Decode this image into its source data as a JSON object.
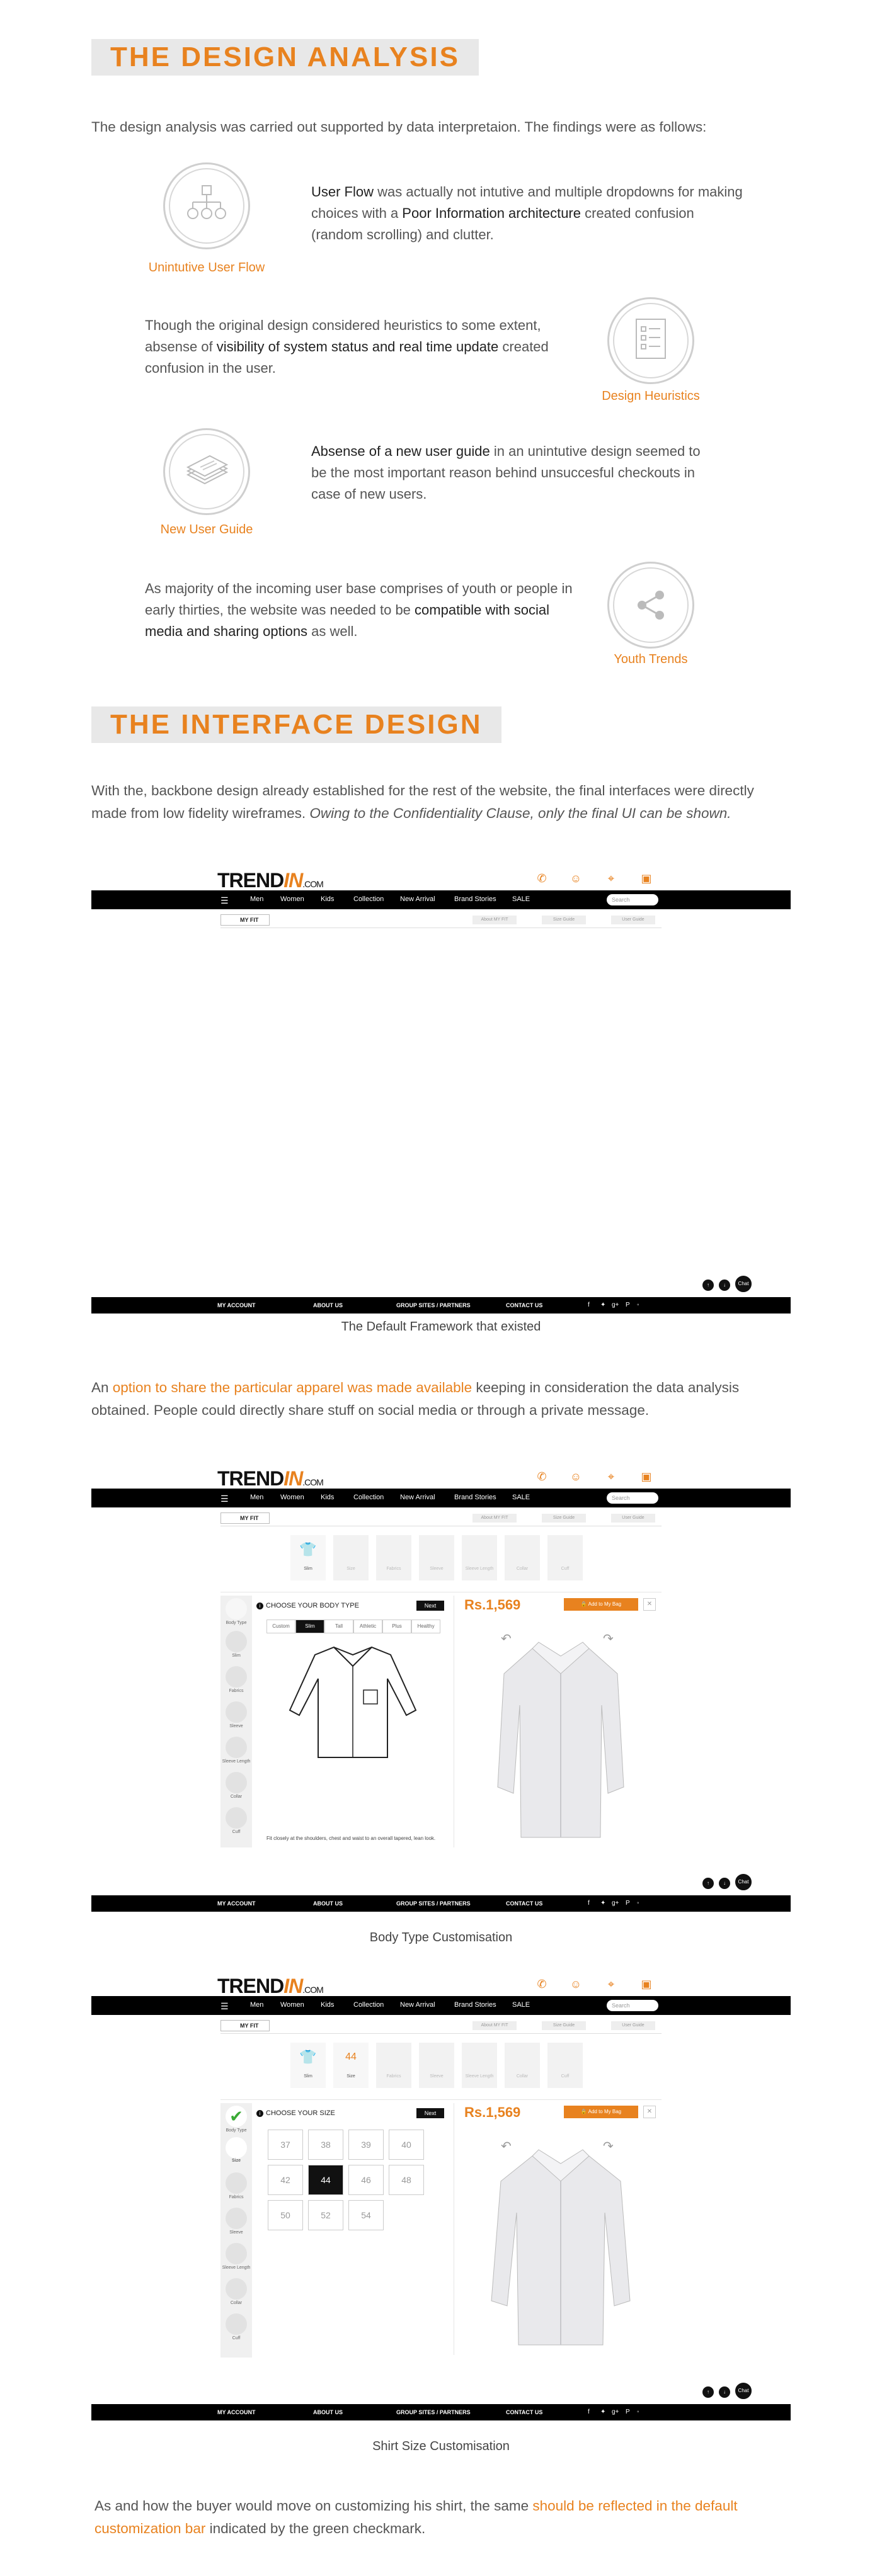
{
  "sections": {
    "design_analysis_title": "THE DESIGN ANALYSIS",
    "interface_design_title": "THE INTERFACE DESIGN"
  },
  "intro": "The design analysis was carried out supported by data interpretaion. The findings were as follows:",
  "findings": [
    {
      "label": "Unintutive User Flow",
      "icon": "flowchart-icon",
      "p1": "User Flow",
      "p2": " was actually not intutive and multiple dropdowns for making choices with a ",
      "p3": "Poor Information architecture",
      "p4": " created confusion (random scrolling) and clutter."
    },
    {
      "label": "Design Heuristics",
      "icon": "checklist-icon",
      "p1": "Though the original design considered heuristics to some extent, absense of ",
      "p2": "visibility of system status and real time update",
      "p3": " created confusion in the user."
    },
    {
      "label": "New User Guide",
      "icon": "papers-icon",
      "p1": "Absense of a new user guide",
      "p2": " in an unintutive design seemed to be the most important reason behind unsuccesful checkouts in case of new users."
    },
    {
      "label": "Youth Trends",
      "icon": "share-icon",
      "p1": "As majority of the incoming user base comprises of youth or people in early thirties, the website was needed to be ",
      "p2": "compatible with social media and sharing options",
      "p3": " as well."
    }
  ],
  "interface_para": {
    "p1": "With the, backbone design already established for the rest of the website, the final interfaces were directly made from low fidelity wireframes. ",
    "p2": "Owing to the Confidentiality Clause, only the final UI can be shown."
  },
  "share_para": {
    "p0": "An ",
    "p1": "option to share the particular apparel was made available",
    "p2": " keeping in consideration the data analysis obtained. People could directly share stuff on social media or through a private message."
  },
  "final_para": {
    "p0": "As and how the buyer would move on customizing his shirt, the same ",
    "p1": "should be reflected in the default customization bar",
    "p2": " indicated by the green checkmark."
  },
  "captions": [
    "The Default Framework that existed",
    "Body Type Customisation",
    "Shirt Size Customisation"
  ],
  "site": {
    "logo_main": "TREND",
    "logo_accent": "IN",
    "logo_suffix": ".COM",
    "header_icons": [
      "phone-icon",
      "user-icon",
      "location-icon",
      "bag-icon"
    ],
    "nav": [
      "Men",
      "Women",
      "Kids",
      "Collection",
      "New Arrival",
      "Brand Stories",
      "SALE"
    ],
    "search_placeholder": "Search",
    "myfit": "MY FIT",
    "subtabs": [
      "About MY FIT",
      "Size Guide",
      "User Guide"
    ],
    "footer": [
      "MY ACCOUNT",
      "ABOUT US",
      "GROUP SITES / PARTNERS",
      "CONTACT US"
    ],
    "social": [
      "f",
      "✦",
      "g+",
      "P",
      "◦"
    ],
    "steps": [
      "Slim",
      "Size",
      "Fabrics",
      "Sleeve",
      "Sleeve Length",
      "Collar",
      "Cuff"
    ],
    "size_step_value": "44",
    "sidebar": [
      "Body Type",
      "Slim",
      "Fabrics",
      "Sleeve",
      "Sleeve Length",
      "Collar",
      "Cuff"
    ],
    "sidebar_size": "Size",
    "body_panel_title": "CHOOSE YOUR BODY TYPE",
    "size_panel_title": "CHOOSE YOUR SIZE",
    "next": "Next",
    "price": "Rs.1,569",
    "bag": "Add to My Bag",
    "body_tabs": [
      "Custom",
      "Slim",
      "Tall",
      "Athletic",
      "Plus",
      "Healthy"
    ],
    "body_note": "Fit closely at the shoulders, chest and waist to an overall tapered, lean look.",
    "sizes": [
      "37",
      "38",
      "39",
      "40",
      "42",
      "44",
      "46",
      "48",
      "50",
      "52",
      "54"
    ],
    "selected_size": "44",
    "fab": [
      "↑",
      "↓",
      "Chat"
    ]
  },
  "colors": {
    "accent": "#e8821f",
    "black": "#000000",
    "check": "#3aaa35"
  }
}
